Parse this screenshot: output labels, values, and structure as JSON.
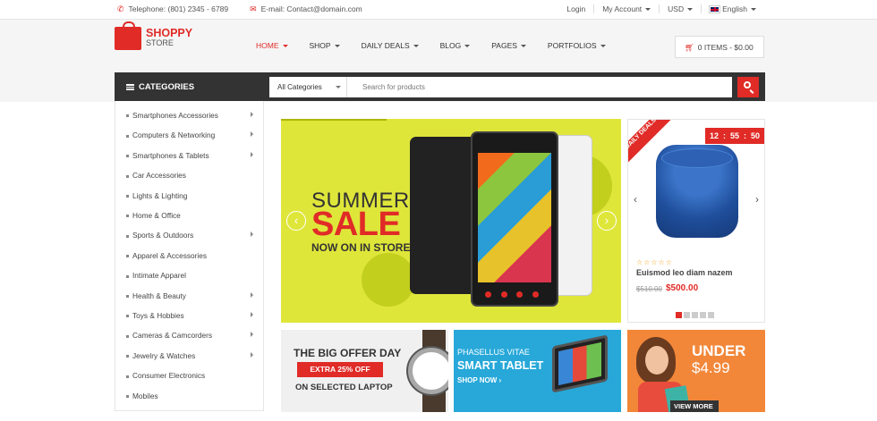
{
  "topbar": {
    "phone": "Telephone: (801) 2345 - 6789",
    "email": "E-mail: Contact@domain.com",
    "login": "Login",
    "account": "My Account",
    "currency": "USD",
    "language": "English"
  },
  "logo": {
    "line1": "SHOPPY",
    "line2": "STORE"
  },
  "nav": [
    "HOME",
    "SHOP",
    "DAILY DEALS",
    "BLOG",
    "PAGES",
    "PORTFOLIOS"
  ],
  "cart": {
    "label": "0 ITEMS - $0.00"
  },
  "categories": {
    "title": "CATEGORIES",
    "items": [
      {
        "label": "Smartphones Accessories",
        "sub": true
      },
      {
        "label": "Computers & Networking",
        "sub": true
      },
      {
        "label": "Smartphones & Tablets",
        "sub": true
      },
      {
        "label": "Car Accessories",
        "sub": false
      },
      {
        "label": "Lights & Lighting",
        "sub": false
      },
      {
        "label": "Home & Office",
        "sub": false
      },
      {
        "label": "Sports & Outdoors",
        "sub": true
      },
      {
        "label": "Apparel & Accessories",
        "sub": false
      },
      {
        "label": "Intimate Apparel",
        "sub": false
      },
      {
        "label": "Health & Beauty",
        "sub": true
      },
      {
        "label": "Toys & Hobbies",
        "sub": true
      },
      {
        "label": "Cameras & Camcorders",
        "sub": true
      },
      {
        "label": "Jewelry & Watches",
        "sub": true
      },
      {
        "label": "Consumer Electronics",
        "sub": false
      },
      {
        "label": "Mobiles",
        "sub": false
      }
    ]
  },
  "search": {
    "category": "All Categories",
    "placeholder": "Search for products"
  },
  "slider": {
    "line1": "SUMMER",
    "line2": "SALE",
    "line3": "NOW ON IN STORE"
  },
  "deal": {
    "ribbon": "DAILY DEALS",
    "timer": [
      "12",
      "55",
      "50"
    ],
    "name": "Euismod leo diam nazem",
    "old_price": "$510.00",
    "new_price": "$500.00",
    "stars": "☆☆☆☆☆"
  },
  "banners": {
    "b1": {
      "title": "THE BIG OFFER DAY",
      "pill": "EXTRA 25% OFF",
      "sub": "ON SELECTED LAPTOP"
    },
    "b2": {
      "line1": "PHASELLUS VITAE",
      "line2": "SMART TABLET",
      "cta": "SHOP NOW ›"
    },
    "b3": {
      "line1": "UNDER",
      "line2": "$4.99",
      "cta": "VIEW MORE"
    }
  }
}
